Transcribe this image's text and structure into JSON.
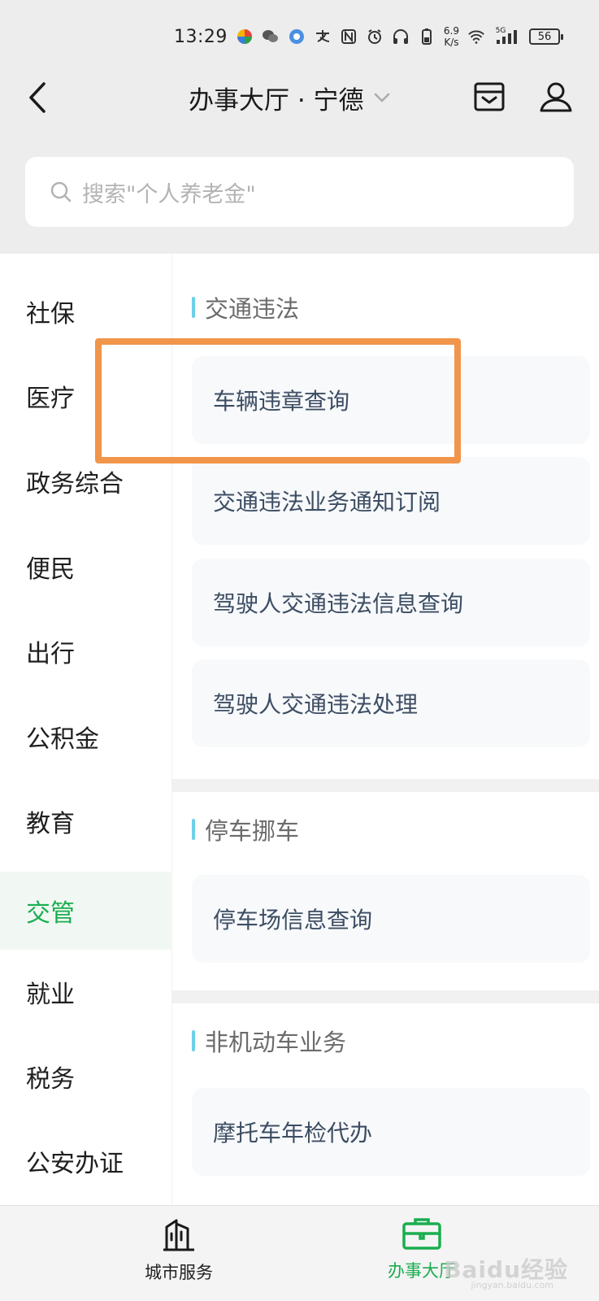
{
  "status_bar": {
    "time": "13:29",
    "network_speed_value": "6.9",
    "network_speed_unit": "K/s",
    "signal_label": "5G",
    "battery": "56"
  },
  "nav": {
    "title": "办事大厅 · 宁德"
  },
  "search": {
    "placeholder": "搜索\"个人养老金\""
  },
  "sidebar": {
    "items": [
      {
        "label": "社保"
      },
      {
        "label": "医疗"
      },
      {
        "label": "政务综合"
      },
      {
        "label": "便民"
      },
      {
        "label": "出行"
      },
      {
        "label": "公积金"
      },
      {
        "label": "教育"
      },
      {
        "label": "交管"
      },
      {
        "label": "就业"
      },
      {
        "label": "税务"
      },
      {
        "label": "公安办证"
      }
    ],
    "active": "交管"
  },
  "sections": [
    {
      "title": "交通违法",
      "items": [
        "车辆违章查询",
        "交通违法业务通知订阅",
        "驾驶人交通违法信息查询",
        "驾驶人交通违法处理"
      ]
    },
    {
      "title": "停车挪车",
      "items": [
        "停车场信息查询"
      ]
    },
    {
      "title": "非机动车业务",
      "items": [
        "摩托车年检代办"
      ]
    }
  ],
  "tabs": [
    {
      "label": "城市服务"
    },
    {
      "label": "办事大厅"
    }
  ],
  "watermark": {
    "text": "Baidu经验",
    "sub": "jingyan.baidu.com"
  },
  "colors": {
    "accent": "#1aad4f",
    "highlight": "#f0954a",
    "section_bar": "#6ed0e8"
  }
}
